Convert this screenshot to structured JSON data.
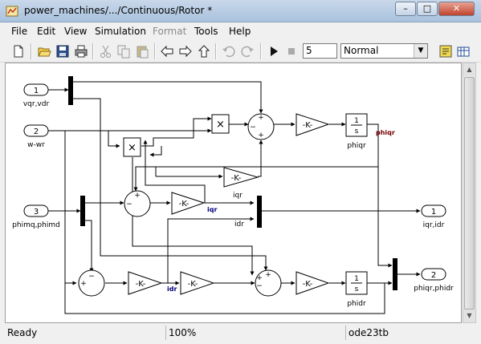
{
  "window": {
    "title": "power_machines/.../Continuous/Rotor *",
    "controls": [
      "minimize-icon",
      "maximize-icon",
      "close-icon"
    ]
  },
  "menu": [
    {
      "label": "File",
      "enabled": true
    },
    {
      "label": "Edit",
      "enabled": true
    },
    {
      "label": "View",
      "enabled": true
    },
    {
      "label": "Simulation",
      "enabled": true
    },
    {
      "label": "Format",
      "enabled": false
    },
    {
      "label": "Tools",
      "enabled": true
    },
    {
      "label": "Help",
      "enabled": true
    }
  ],
  "toolbar": {
    "icons": [
      "new-model-icon",
      "open-icon",
      "save-icon",
      "print-icon",
      "cut-icon",
      "copy-icon",
      "paste-icon",
      "back-icon",
      "forward-icon",
      "up-icon",
      "undo-icon",
      "redo-icon",
      "start-icon",
      "stop-icon",
      "model-advisor-icon",
      "library-browser-icon"
    ],
    "stop_time": "5",
    "sim_mode": "Normal"
  },
  "diagram": {
    "inports": [
      {
        "number": "1",
        "label": "vqr,vdr"
      },
      {
        "number": "2",
        "label": "w-wr"
      },
      {
        "number": "3",
        "label": "phimq,phimd"
      }
    ],
    "outports": [
      {
        "number": "1",
        "label": "iqr,idr"
      },
      {
        "number": "2",
        "label": "phiqr,phidr"
      }
    ],
    "gains": {
      "symbol": "-K-"
    },
    "integrators": [
      {
        "numerator": "1",
        "denominator": "s",
        "label": "phiqr"
      },
      {
        "numerator": "1",
        "denominator": "s",
        "label": "phidr"
      }
    ],
    "products": {
      "symbol": "×"
    },
    "signal_labels": {
      "phiqr": "phiqr",
      "iqr_gain": "iqr",
      "iqr_signal": "iqr",
      "idr_gain": "idr",
      "idr_signal": "idr"
    },
    "sum_signs": {
      "plus": "+",
      "minus": "−"
    }
  },
  "status": {
    "text": "Ready",
    "zoom": "100%",
    "solver": "ode23tb"
  }
}
